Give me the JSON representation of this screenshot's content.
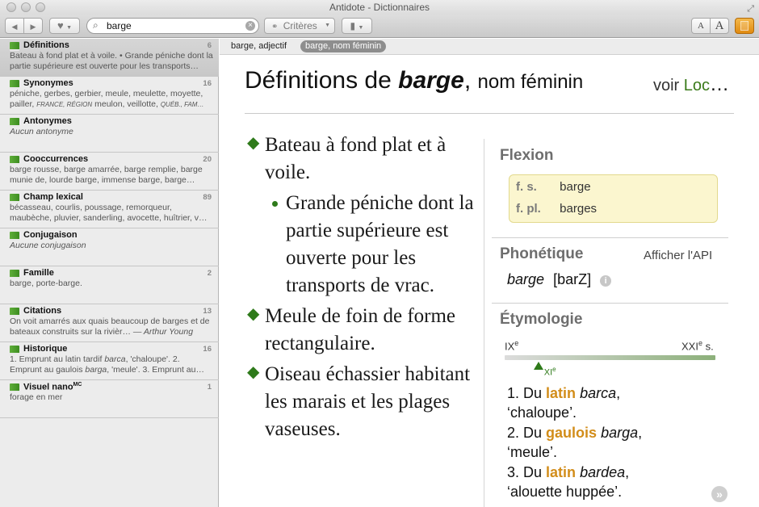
{
  "window": {
    "title": "Antidote - Dictionnaires"
  },
  "toolbar": {
    "back_icon": "◀",
    "forward_icon": "▶",
    "favorites_icon": "♥",
    "search_value": "barge",
    "criteria_label": "Critères",
    "trash_icon": "🗑",
    "font_smaller": "A",
    "font_larger": "A"
  },
  "sidebar": {
    "items": [
      {
        "title": "Définitions",
        "count": "6",
        "desc": "Bateau à fond plat et à voile. • Grande péniche dont la partie supérieure est ouverte pour les transports…"
      },
      {
        "title": "Synonymes",
        "count": "16",
        "desc": "péniche, gerbes, gerbier, meule, meulette, moyette, pailler,",
        "desc_tag1": "FRANCE, RÉGION",
        "desc_mid": "meulon, veillotte,",
        "desc_tag2": "QUÉB., FAM…"
      },
      {
        "title": "Antonymes",
        "count": "",
        "desc": "Aucun antonyme"
      },
      {
        "title": "Cooccurrences",
        "count": "20",
        "desc": "barge rousse, barge amarrée, barge remplie, barge munie de, lourde barge, immense barge, barge…"
      },
      {
        "title": "Champ lexical",
        "count": "89",
        "desc": "bécasseau, courlis, poussage, remorqueur, maubèche, pluvier, sanderling, avocette, huîtrier, v…"
      },
      {
        "title": "Conjugaison",
        "count": "",
        "desc": "Aucune conjugaison"
      },
      {
        "title": "Famille",
        "count": "2",
        "desc": "barge, porte-barge."
      },
      {
        "title": "Citations",
        "count": "13",
        "desc": "On voit amarrés aux quais beaucoup de barges et de bateaux construits sur la rivièr…",
        "author": "— Arthur Young"
      },
      {
        "title": "Historique",
        "count": "16",
        "desc_part1": "1. Emprunt au latin tardif ",
        "desc_it1": "barca",
        "desc_part2": ", 'chaloupe'. 2. Emprunt au gaulois ",
        "desc_it2": "barga",
        "desc_part3": ", 'meule'. 3. Emprunt au…"
      },
      {
        "title": "Visuel nano",
        "title_sup": "MC",
        "count": "1",
        "desc": "forage en mer"
      }
    ]
  },
  "subtabs": [
    "barge, adjectif",
    "barge, nom féminin"
  ],
  "header": {
    "prefix": "Définitions de",
    "word": "barge",
    "separator": ",",
    "category": "nom féminin",
    "voir": "voir",
    "loc": "Loc",
    "ellipsis": "…"
  },
  "definitions": {
    "def1": "Bateau à fond plat et à voile.",
    "def1_sub": "Grande péniche dont la partie supérieure est ouverte pour les transports de vrac.",
    "def2": "Meule de foin de forme rectangulaire.",
    "def3": "Oiseau échassier habitant les marais et les plages vaseuses."
  },
  "flexion": {
    "title": "Flexion",
    "rows": [
      {
        "label": "f. s.",
        "value": "barge"
      },
      {
        "label": "f. pl.",
        "value": "barges"
      }
    ]
  },
  "phonetique": {
    "title": "Phonétique",
    "show_api": "Afficher l'API",
    "word": "barge",
    "ipa": "[barZ]",
    "info_icon": "i"
  },
  "etymologie": {
    "title": "Étymologie",
    "timeline_start": "IX",
    "timeline_start_sup": "e",
    "timeline_end": "XXI",
    "timeline_end_sup": "e",
    "timeline_end_suffix": " s.",
    "marker_label": "XI",
    "marker_sup": "e",
    "marker_position": 0.16,
    "items": [
      {
        "num": "1. Du",
        "lang": "latin",
        "term": "barca",
        "gloss": "‘chaloupe’."
      },
      {
        "num": "2. Du",
        "lang": "gaulois",
        "term": "barga",
        "gloss": "‘meule’."
      },
      {
        "num": "3. Du",
        "lang": "latin",
        "term": "bardea",
        "gloss": "‘alouette huppée’."
      }
    ]
  },
  "colors": {
    "accent_green": "#2e7a1a",
    "lang_orange": "#d28d1a",
    "flexion_bg": "#fbf6cf",
    "toolbar_orange": "#e89a1f"
  }
}
